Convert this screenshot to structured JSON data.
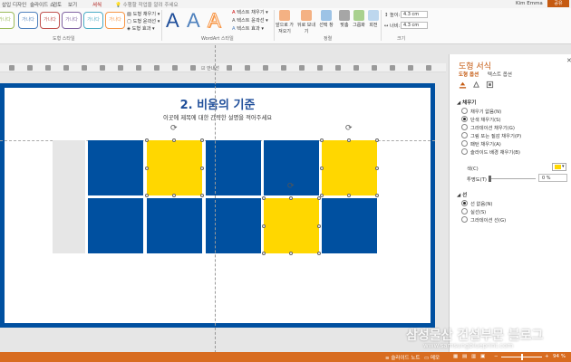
{
  "tabs": [
    "삽입",
    "디자인",
    "슬라이드 쇼",
    "검토",
    "보기",
    "서식"
  ],
  "active_tab": "서식",
  "tell_me": "수행할 작업을 알려 주세요",
  "user": "Kim Emma",
  "share": "공유",
  "ribbon": {
    "style_thumbs": [
      "가나다",
      "가나다",
      "가나다",
      "가나다",
      "가나다",
      "가나다"
    ],
    "shape_styles_label": "도형 스타일",
    "shape_fill": "도형 채우기",
    "shape_outline": "도형 윤곽선",
    "shape_effects": "도형 효과",
    "wordart_label": "WordArt 스타일",
    "text_fill": "텍스트 채우기",
    "text_outline": "텍스트 윤곽선",
    "text_effects": "텍스트 효과",
    "bring_forward": "앞으로 가져오기",
    "send_backward": "뒤로 보내기",
    "selection_pane": "선택 창",
    "align": "맞춤",
    "group": "그룹화",
    "rotate": "회전",
    "arrange_label": "정렬",
    "height_label": "높이:",
    "height_value": "4.3 cm",
    "width_label": "너비:",
    "width_value": "4.3 cm",
    "size_label": "크기"
  },
  "qrow_label": "안내선",
  "slide": {
    "title": "2. 비움의 기준",
    "subtitle": "이곳에 제목에 대한 간략한 설명을 적어주세요"
  },
  "pane": {
    "title": "도형 서식",
    "tab_shape": "도형 옵션",
    "tab_text": "텍스트 옵션",
    "fill_section": "채우기",
    "fill_options": [
      "채우기 없음(N)",
      "단색 채우기(S)",
      "그라데이션 채우기(G)",
      "그림 또는 질감 채우기(P)",
      "패턴 채우기(A)",
      "슬라이드 배경 채우기(B)"
    ],
    "fill_selected": 1,
    "color_label": "색(C)",
    "transparency_label": "투명도(T)",
    "transparency_value": "0 %",
    "line_section": "선",
    "line_options": [
      "선 없음(N)",
      "실선(S)",
      "그라데이션 선(G)"
    ],
    "line_selected": 0
  },
  "statusbar": {
    "notes": "슬라이드 노트",
    "comments": "메모",
    "zoom": "94 %"
  },
  "watermark": {
    "title": "삼성물산 건설부문 블로그",
    "url": "www.samsungblueprint.com"
  },
  "colors": {
    "slide_blue": "#0050a0",
    "tile_yellow": "#ffd700",
    "accent": "#c55a11"
  }
}
